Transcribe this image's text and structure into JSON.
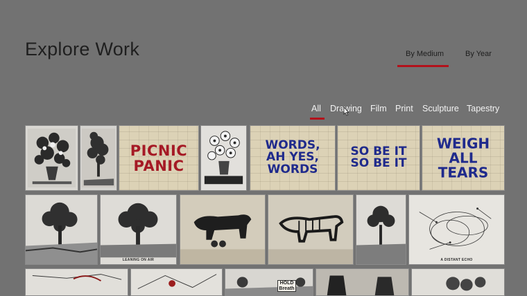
{
  "header": {
    "title": "Explore Work"
  },
  "view_modes": {
    "items": [
      {
        "label": "By Medium",
        "active": true
      },
      {
        "label": "By Year",
        "active": false
      }
    ]
  },
  "filters": {
    "items": [
      {
        "label": "All",
        "active": true
      },
      {
        "label": "Drawing",
        "active": false
      },
      {
        "label": "Film",
        "active": false
      },
      {
        "label": "Print",
        "active": false
      },
      {
        "label": "Sculpture",
        "active": false
      },
      {
        "label": "Tapestry",
        "active": false
      }
    ]
  },
  "artworks": {
    "picnic_panic": {
      "lines": [
        "PICNIC",
        "PANIC"
      ]
    },
    "words_ah_yes": {
      "lines": [
        "WORDS,",
        "AH YES,",
        "WORDS"
      ]
    },
    "so_be_it": {
      "lines": [
        "SO BE IT",
        "SO BE IT"
      ]
    },
    "weigh_all_tears": {
      "lines": [
        "WEIGH",
        "ALL",
        "TEARS"
      ]
    },
    "leaning_on_air": {
      "caption": "LEANING ON AIR"
    },
    "distant_echo": {
      "caption": "A DISTANT ECHO"
    },
    "hold": {
      "lines": [
        "HOLD",
        "Breath"
      ]
    }
  },
  "colors": {
    "background": "#727272",
    "accent_underline": "#b3111b",
    "slogan_red": "#a51a25",
    "slogan_blue": "#1f2a8c",
    "paper": "#dcd2b6"
  }
}
